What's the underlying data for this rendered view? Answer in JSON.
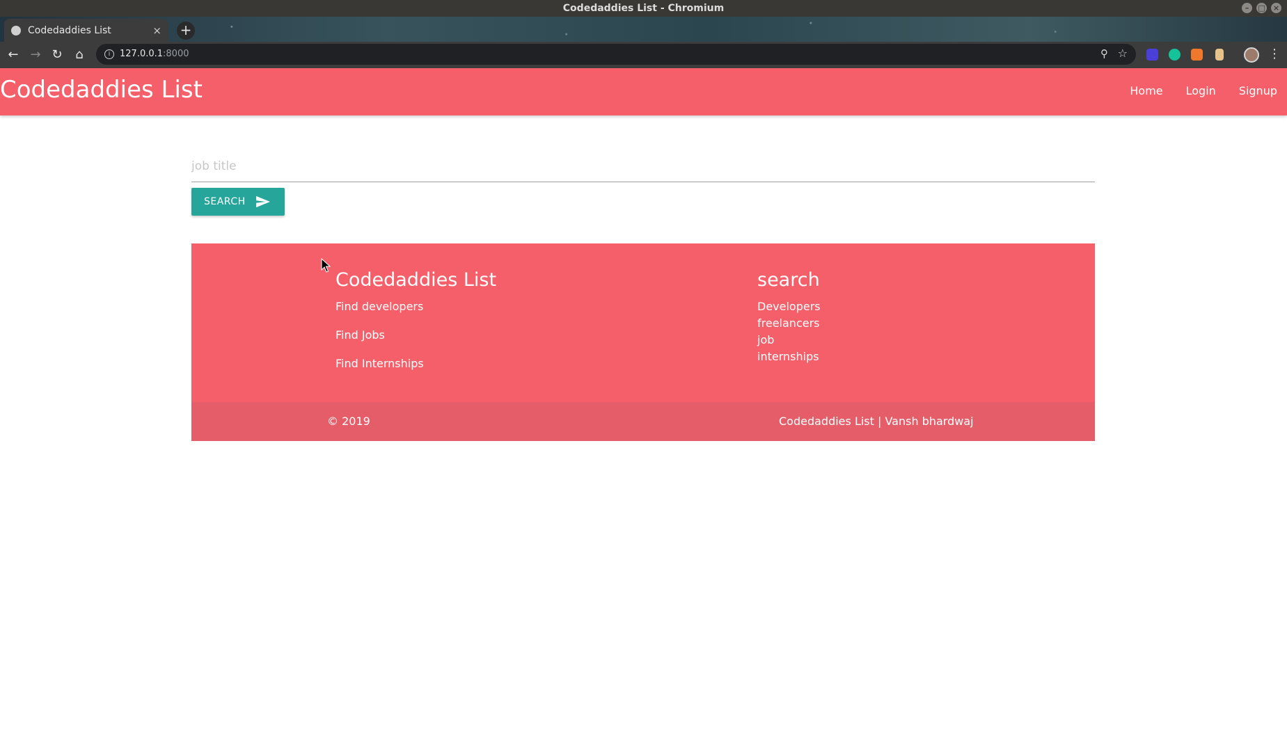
{
  "os": {
    "window_title": "Codedaddies List - Chromium"
  },
  "browser": {
    "tab_title": "Codedaddies List",
    "tab_close": "×",
    "new_tab": "+",
    "url_host": "127.0.0.1",
    "url_port": ":8000"
  },
  "navbar": {
    "brand": "Codedaddies List",
    "links": [
      "Home",
      "Login",
      "Signup"
    ]
  },
  "search": {
    "placeholder": "job title",
    "button_label": "SEARCH"
  },
  "footer": {
    "left_heading": "Codedaddies List",
    "left_links": [
      "Find developers",
      "Find Jobs",
      "Find Internships"
    ],
    "right_heading": "search",
    "right_links": [
      "Developers",
      "freelancers",
      "job",
      "internships"
    ],
    "copyright": "© 2019",
    "credit": "Codedaddies List | Vansh bhardwaj"
  },
  "colors": {
    "brand": "#f45f6a",
    "footer_bottom": "#e55d68",
    "button": "#26a69a"
  }
}
